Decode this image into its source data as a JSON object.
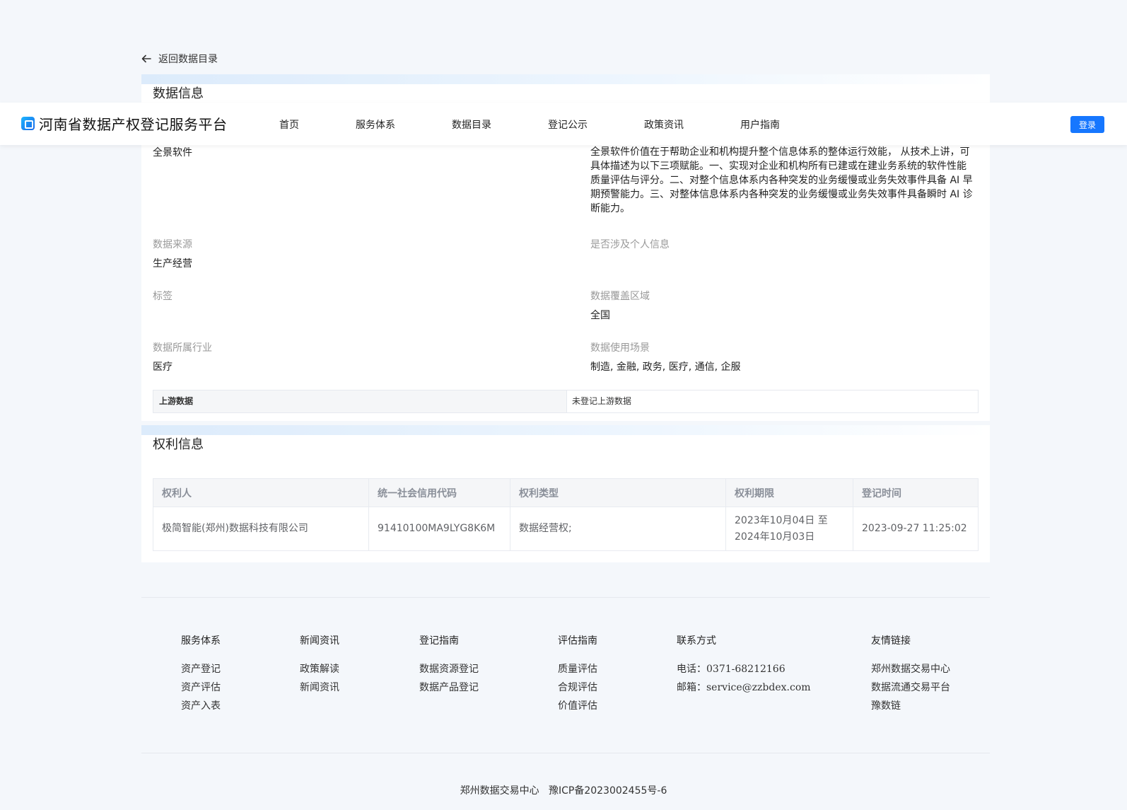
{
  "back_link": "返回数据目录",
  "header": {
    "brand": "河南省数据产权登记服务平台",
    "nav": [
      "首页",
      "服务体系",
      "数据目录",
      "登记公示",
      "政策资讯",
      "用户指南"
    ],
    "login": "登录"
  },
  "data_section": {
    "title": "数据信息",
    "left_top_value": "全景软件",
    "description": "全景软件价值在于帮助企业和机构提升整个信息体系的整体运行效能， 从技术上讲，可具体描述为以下三项赋能。一、实现对企业和机构所有已建或在建业务系统的软件性能质量评估与评分。二、对整个信息体系内各种突发的业务缓慢或业务失效事件具备 AI 早期预警能力。三、对整体信息体系内各种突发的业务缓慢或业务失效事件具备瞬时 AI 诊断能力。",
    "fields": {
      "source_label": "数据来源",
      "source_value": "生产经营",
      "personal_label": "是否涉及个人信息",
      "personal_value": "",
      "tag_label": "标签",
      "tag_value": "",
      "region_label": "数据覆盖区域",
      "region_value": "全国",
      "industry_label": "数据所属行业",
      "industry_value": "医疗",
      "scene_label": "数据使用场景",
      "scene_value": "制造, 金融, 政务, 医疗, 通信, 企服"
    },
    "upstream_label": "上游数据",
    "upstream_value": "未登记上游数据"
  },
  "rights_section": {
    "title": "权利信息",
    "columns": [
      "权利人",
      "统一社会信用代码",
      "权利类型",
      "权利期限",
      "登记时间"
    ],
    "row": {
      "holder": "极简智能(郑州)数据科技有限公司",
      "credit_code": "91410100MA9LYG8K6M",
      "right_type": "数据经营权;",
      "term_line1": "2023年10月04日 至",
      "term_line2": "2024年10月03日",
      "reg_time": "2023-09-27 11:25:02"
    }
  },
  "footer": {
    "cols": [
      {
        "head": "服务体系",
        "items": [
          "资产登记",
          "资产评估",
          "资产入表"
        ]
      },
      {
        "head": "新闻资讯",
        "items": [
          "政策解读",
          "新闻资讯"
        ]
      },
      {
        "head": "登记指南",
        "items": [
          "数据资源登记",
          "数据产品登记"
        ]
      },
      {
        "head": "评估指南",
        "items": [
          "质量评估",
          "合规评估",
          "价值评估"
        ]
      },
      {
        "head": "联系方式",
        "phone_label": "电话：",
        "phone": "0371-68212166",
        "email_label": "邮箱：",
        "email": "service@zzbdex.com"
      },
      {
        "head": "友情链接",
        "items": [
          "郑州数据交易中心",
          "数据流通交易平台",
          "豫数链"
        ]
      }
    ],
    "copyright_org": "郑州数据交易中心",
    "copyright_icp": "豫ICP备2023002455号-6"
  }
}
